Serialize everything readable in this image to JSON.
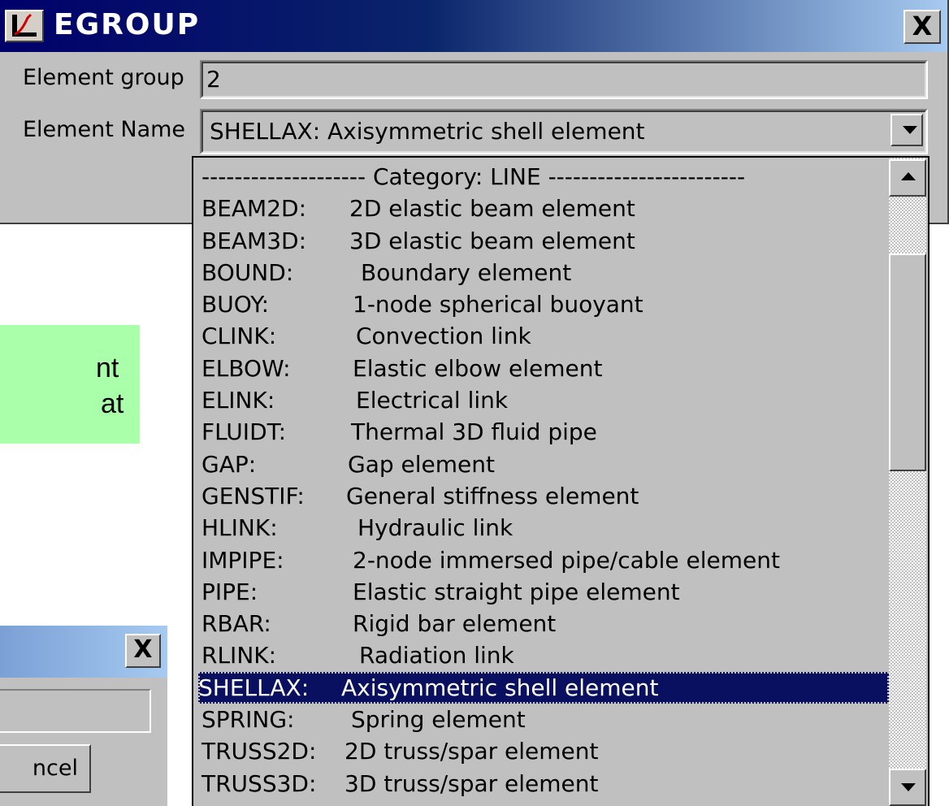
{
  "window": {
    "title": "EGROUP",
    "close_label": "X"
  },
  "form": {
    "group_label": "Element group",
    "group_value": "2",
    "name_label": "Element Name",
    "name_value": "SHELLAX:  Axisymmetric shell element"
  },
  "dropdown": {
    "category": "-------------------- Category: LINE ------------------------",
    "items": [
      {
        "code": "BEAM2D:",
        "desc": "2D elastic beam element"
      },
      {
        "code": "BEAM3D:",
        "desc": "3D elastic beam element"
      },
      {
        "code": "BOUND:",
        "desc": "Boundary element"
      },
      {
        "code": "BUOY:",
        "desc": "1-node spherical buoyant"
      },
      {
        "code": "CLINK:",
        "desc": "Convection link"
      },
      {
        "code": "ELBOW:",
        "desc": "Elastic elbow element"
      },
      {
        "code": "ELINK:",
        "desc": "Electrical link"
      },
      {
        "code": "FLUIDT:",
        "desc": "Thermal 3D fluid pipe"
      },
      {
        "code": "GAP:",
        "desc": "Gap element"
      },
      {
        "code": "GENSTIF:",
        "desc": "General stiffness element"
      },
      {
        "code": "HLINK:",
        "desc": "Hydraulic link"
      },
      {
        "code": "IMPIPE:",
        "desc": "2-node immersed pipe/cable element"
      },
      {
        "code": "PIPE:",
        "desc": "Elastic straight pipe element"
      },
      {
        "code": "RBAR:",
        "desc": "Rigid bar element"
      },
      {
        "code": "RLINK:",
        "desc": "Radiation link"
      },
      {
        "code": "SHELLAX:",
        "desc": "Axisymmetric shell element",
        "selected": true
      },
      {
        "code": "SPRING:",
        "desc": "Spring element"
      },
      {
        "code": "TRUSS2D:",
        "desc": "2D truss/spar element"
      },
      {
        "code": "TRUSS3D:",
        "desc": "3D truss/spar element"
      }
    ]
  },
  "background": {
    "note_line1": "nt",
    "note_line2": "at",
    "dialog2_close": "X",
    "dialog2_button": "ncel"
  }
}
